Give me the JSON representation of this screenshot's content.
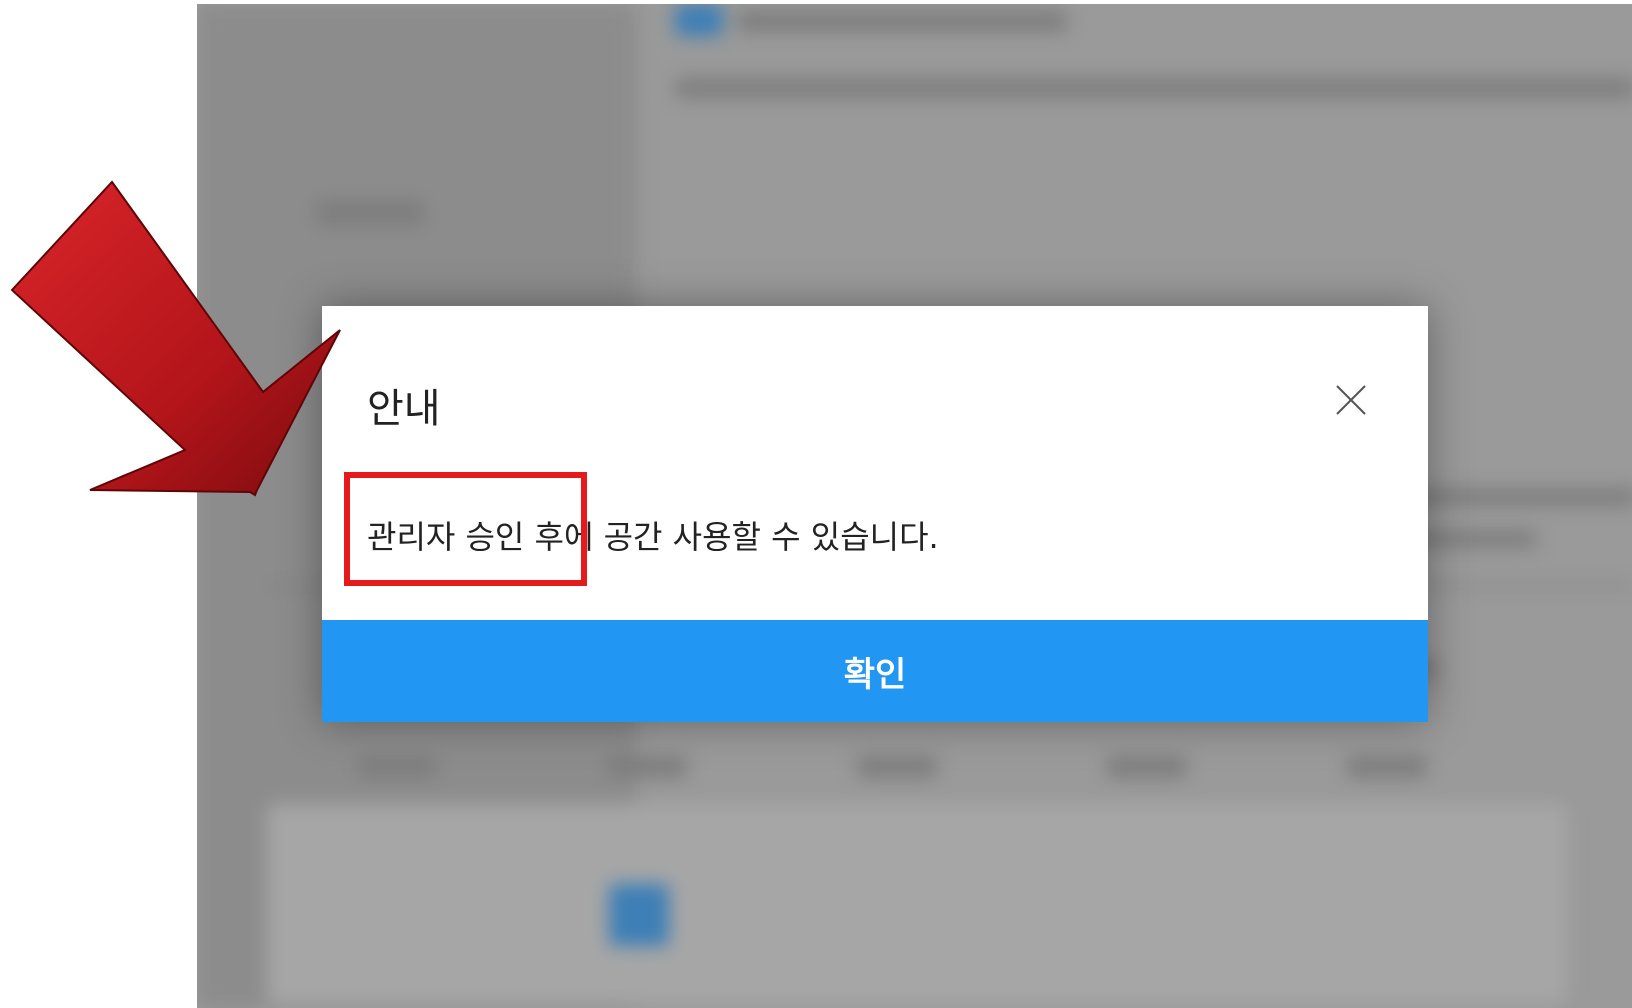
{
  "dialog": {
    "title": "안내",
    "message": "관리자 승인 후에 공간 사용할 수 있습니다.",
    "confirm_label": "확인",
    "close_icon": "close-icon"
  },
  "annotations": {
    "arrow_icon": "red-arrow-icon",
    "arrow_color": "#c8191c",
    "highlight_color": "#e51a1a"
  },
  "colors": {
    "confirm_button": "#2196f3",
    "backdrop": "#9a9a9a"
  }
}
